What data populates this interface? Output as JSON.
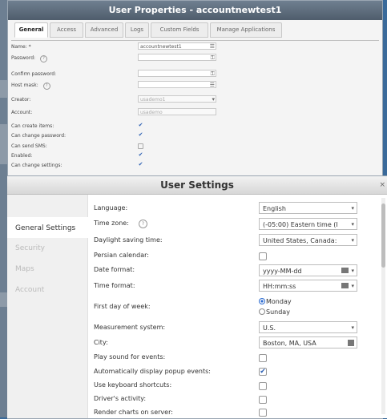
{
  "user_properties": {
    "title": "User Properties - accountnewtest1",
    "tabs": [
      "General",
      "Access",
      "Advanced",
      "Logs",
      "Custom Fields",
      "Manage Applications"
    ],
    "fields": {
      "name_label": "Name: *",
      "name_value": "accountnewtest1",
      "password_label": "Password:",
      "confirm_password_label": "Confirm password:",
      "host_mask_label": "Host mask:",
      "creator_label": "Creator:",
      "creator_value": "usademo1",
      "account_label": "Account:",
      "account_value": "usademo"
    },
    "permissions": [
      {
        "label": "Can create items:",
        "checked": true
      },
      {
        "label": "Can change password:",
        "checked": true
      },
      {
        "label": "Can send SMS:",
        "checked": false
      },
      {
        "label": "Enabled:",
        "checked": true
      },
      {
        "label": "Can change settings:",
        "checked": true
      }
    ]
  },
  "user_settings": {
    "title": "User Settings",
    "close": "×",
    "sidebar": [
      "General Settings",
      "Security",
      "Maps",
      "Account"
    ],
    "active_sidebar": "General Settings",
    "labels": {
      "language": "Language:",
      "time_zone": "Time zone:",
      "dst": "Daylight saving time:",
      "persian": "Persian calendar:",
      "date_format": "Date format:",
      "time_format": "Time format:",
      "first_day": "First day of week:",
      "measurement": "Measurement system:",
      "city": "City:",
      "play_sound": "Play sound for events:",
      "auto_popup": "Automatically display popup events:",
      "keyboard": "Use keyboard shortcuts:",
      "driver_activity": "Driver's activity:",
      "render_charts": "Render charts on server:"
    },
    "values": {
      "language": "English",
      "time_zone": "(-05:00) Eastern time (I",
      "dst": "United States, Canada:",
      "date_format": "yyyy-MM-dd",
      "time_format": "HH:mm:ss",
      "first_day_monday": "Monday",
      "first_day_sunday": "Sunday",
      "measurement": "U.S.",
      "city": "Boston, MA, USA"
    },
    "checks": {
      "persian": false,
      "play_sound": false,
      "auto_popup": true,
      "keyboard": false,
      "driver_activity": false,
      "render_charts": false
    }
  },
  "colors": {
    "accent": "#2b5fb3",
    "titlebar": "#56657a",
    "background": "#3a6a9a"
  }
}
